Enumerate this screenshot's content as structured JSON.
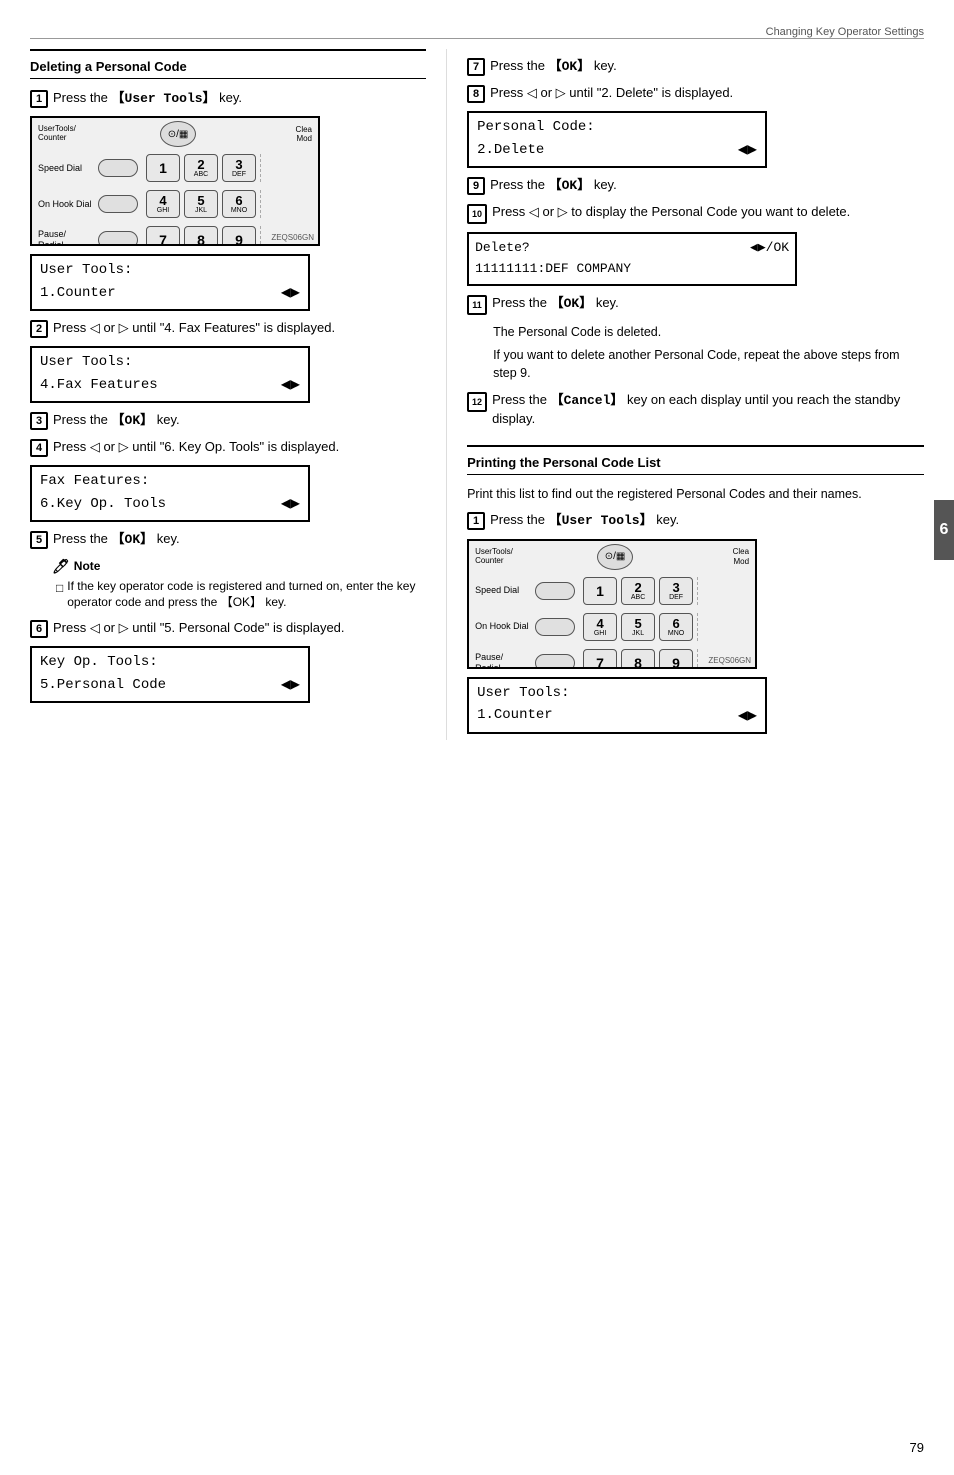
{
  "header": {
    "top_label": "Changing Key Operator Settings"
  },
  "left_section": {
    "title": "Deleting a Personal Code",
    "steps": [
      {
        "num": "1",
        "text": "Press the 【User Tools】 key."
      },
      {
        "num": "2",
        "text": "Press ◁ or ▷ until \"4. Fax Features\" is displayed."
      },
      {
        "num": "3",
        "text": "Press the 【OK】 key."
      },
      {
        "num": "4",
        "text": "Press ◁ or ▷ until \"6. Key Op. Tools\" is displayed."
      },
      {
        "num": "5",
        "text": "Press the 【OK】 key."
      },
      {
        "num": "6",
        "text": "Press ◁ or ▷ until \"5. Personal Code\" is displayed."
      }
    ],
    "lcd1": {
      "line1": "User Tools:",
      "line2": "1.Counter",
      "arrow": "◀▶"
    },
    "lcd2": {
      "line1": "User Tools:",
      "line2": "4.Fax Features",
      "arrow": "◀▶"
    },
    "lcd3": {
      "line1": "Fax Features:",
      "line2": "6.Key Op. Tools",
      "arrow": "◀▶"
    },
    "lcd4": {
      "line1": "Key Op. Tools:",
      "line2": "5.Personal Code",
      "arrow": "◀▶"
    },
    "note": {
      "title": "Note",
      "items": [
        "If the key operator code is registered and turned on, enter the key operator code and press the 【OK】 key."
      ]
    },
    "keyboard_label": "ZEQS06GN"
  },
  "right_section": {
    "steps": [
      {
        "num": "7",
        "text": "Press the 【OK】 key."
      },
      {
        "num": "8",
        "text": "Press ◁ or ▷ until \"2. Delete\" is displayed."
      },
      {
        "num": "9",
        "text": "Press the 【OK】 key."
      },
      {
        "num": "10",
        "text": "Press ◁ or ▷ to display the Personal Code you want to delete."
      },
      {
        "num": "11",
        "text": "Press the 【OK】 key."
      },
      {
        "num": "12",
        "text": "Press the 【Cancel】 key on each display until you reach the standby display."
      }
    ],
    "lcd_personal": {
      "line1": "Personal Code:",
      "line2": "2.Delete",
      "arrow": "◀▶"
    },
    "lcd_delete": {
      "line1": "Delete?          ◀▶/OK",
      "line2": "11111111:DEF COMPANY"
    },
    "after_step11_para1": "The Personal Code is deleted.",
    "after_step11_para2": "If you want to delete another Personal Code, repeat the above steps from step 9.",
    "printing_section": {
      "title": "Printing the Personal Code List",
      "desc": "Print this list to find out the registered Personal Codes and their names.",
      "step1_text": "Press the 【User Tools】 key.",
      "lcd_counter": {
        "line1": "User Tools:",
        "line2": "1.Counter",
        "arrow": "◀▶"
      }
    }
  },
  "page_number": "79",
  "tab_number": "6",
  "keyboard": {
    "usertool_label": "UserTools/ Counter",
    "clear_label": "Clear/ Mod",
    "speed_label": "Speed Dial",
    "onhook_label": "On Hook Dial",
    "pause_label": "Pause/ Redial",
    "keys": [
      "1",
      "2\nABC",
      "3\nDEF",
      "4\nGHI",
      "5\nJKL",
      "6\nMNO",
      "7",
      "8",
      "9"
    ],
    "zeq_code": "ZEQS06GN"
  }
}
